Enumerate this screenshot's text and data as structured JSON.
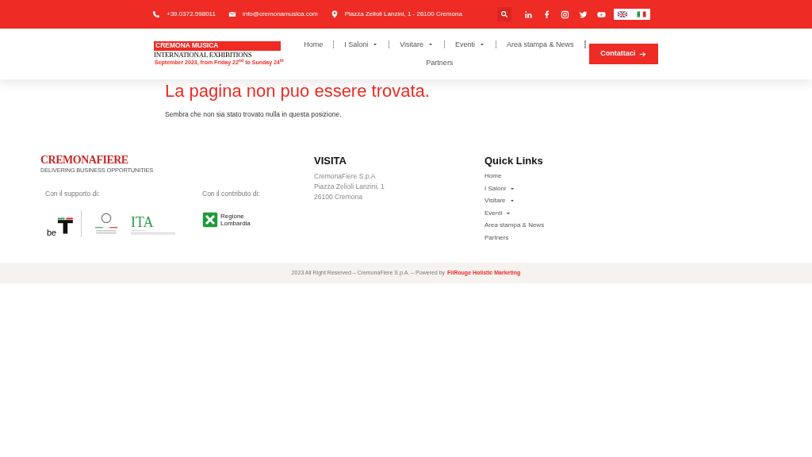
{
  "topbar": {
    "phone": "+39.0372.598011",
    "email": "info@cremonamusica.com",
    "address": "Piazza Zelioli Lanzini, 1 - 26100 Cremona"
  },
  "logo": {
    "line1": "CREMONA MUSICA",
    "line2": "INTERNATIONAL EXHIBITIONS",
    "line3": "September 2023, from Friday 22$^{nd}$ to Sunday 24$^{th}$"
  },
  "nav": [
    {
      "label": "Home",
      "dropdown": false
    },
    {
      "label": "I Saloni",
      "dropdown": true
    },
    {
      "label": "Visitare",
      "dropdown": true
    },
    {
      "label": "Eventi",
      "dropdown": true
    },
    {
      "label": "Area stampa & News",
      "dropdown": false
    },
    {
      "label": "Partners",
      "dropdown": false
    }
  ],
  "cta": "Contattaci",
  "error": {
    "title": "La pagina non puo essere trovata.",
    "message": "Sembra che non sia stato trovato nulla in questa posizione."
  },
  "footer": {
    "brand": {
      "name": "CREMONAFIERE",
      "tagline": "DELIVERING BUSINESS OPPORTUNITIES"
    },
    "support_label": "Con il supporto di:",
    "support_logos": [
      {
        "kind": "beit",
        "text": "be"
      },
      {
        "kind": "ministry"
      },
      {
        "kind": "ita",
        "text": "ITA"
      }
    ],
    "contribution_label": "Con il contributo di:",
    "contribution_logo": "Regione\nLombardia",
    "visit": {
      "title": "VISITA",
      "lines": [
        "CremonaFiere S.p.A",
        "Piazza Zelioli Lanzini, 1",
        "26100 Cremona"
      ]
    },
    "quick_links": {
      "title": "Quick Links",
      "items": [
        {
          "label": "Home",
          "dropdown": false
        },
        {
          "label": "I Saloni",
          "dropdown": true
        },
        {
          "label": "Visitare",
          "dropdown": true
        },
        {
          "label": "Eventi",
          "dropdown": true
        },
        {
          "label": "Area stampa & News",
          "dropdown": false
        },
        {
          "label": "Partners",
          "dropdown": false
        }
      ]
    }
  },
  "copyright": {
    "text": "2023 All Right Reserved – CremonaFiere S.p.A. – Powered by",
    "link": "FilRouge Holistic Marketing"
  }
}
